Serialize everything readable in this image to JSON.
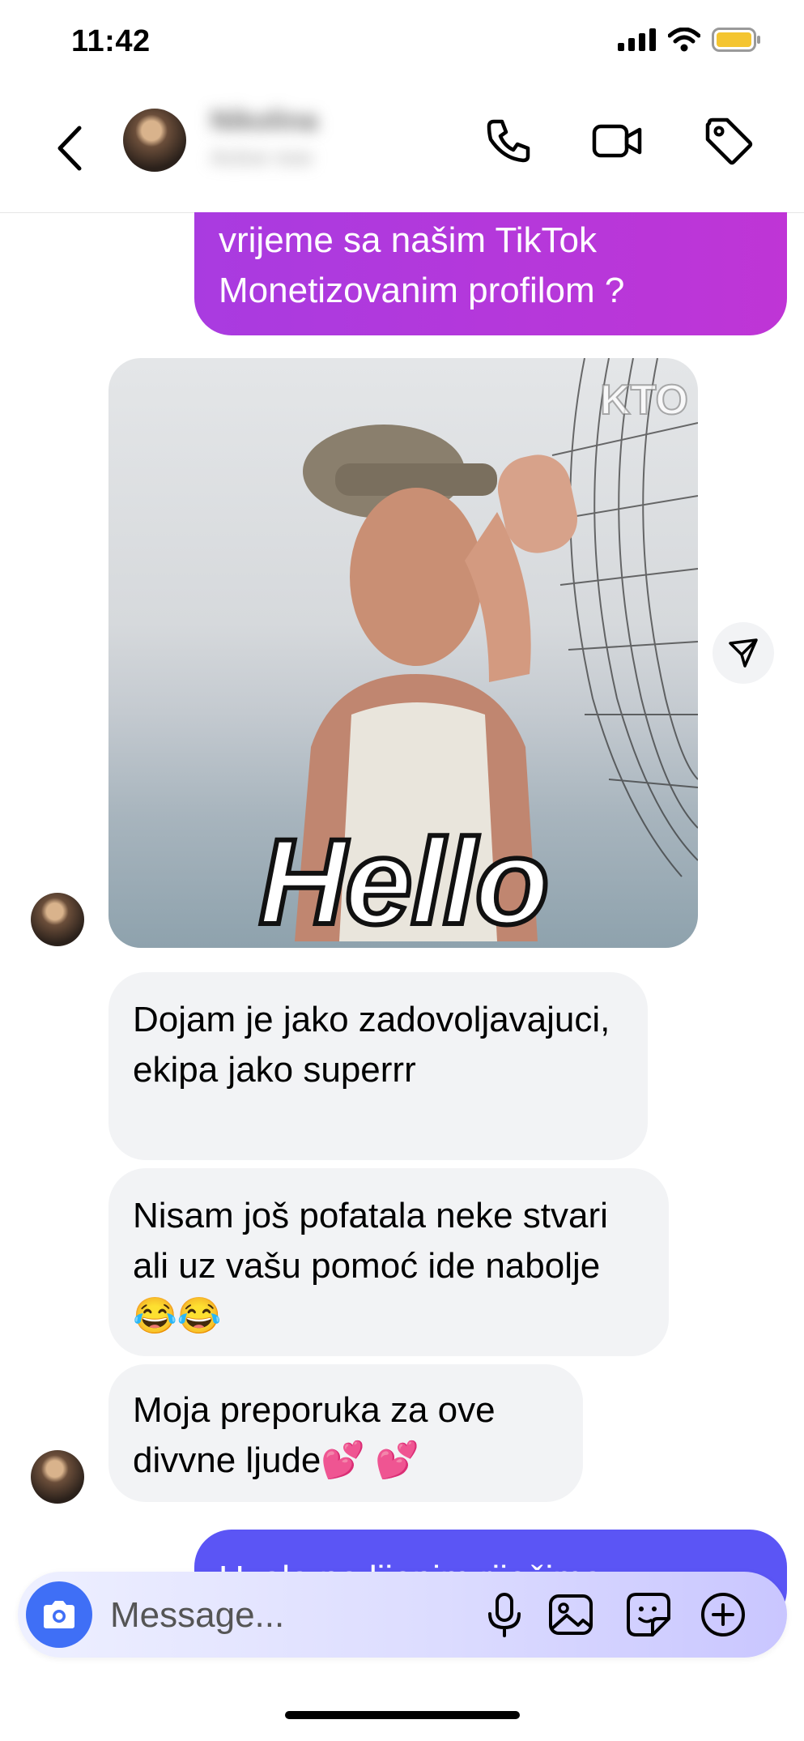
{
  "status_bar": {
    "time": "11:42"
  },
  "header": {
    "contact_name": "Nikolina",
    "contact_sub": "Active now"
  },
  "messages": {
    "outgoing_top": "vrijeme sa našim TikTok Monetizovanim profilom ?",
    "gif_text": "Hello",
    "gif_watermark": "KTO",
    "incoming_1": "Dojam je jako zadovoljavajuci, ekipa jako superrr",
    "incoming_2": "Nisam još pofatala neke stvari ali uz vašu pomoć ide nabolje 😂😂",
    "incoming_3": "Moja preporuka za ove divvne ljude💕 💕",
    "outgoing_bottom": "Hvala na lijepim riječima"
  },
  "composer": {
    "placeholder": "Message..."
  },
  "colors": {
    "outgoing": "#b938da",
    "outgoing_bottom": "#5b55f5",
    "incoming": "#f2f3f5",
    "camera": "#3f6ff6"
  },
  "icons": [
    "back-icon",
    "phone-icon",
    "video-icon",
    "tag-icon",
    "share-icon",
    "camera-icon",
    "microphone-icon",
    "gallery-icon",
    "sticker-icon",
    "plus-icon"
  ]
}
